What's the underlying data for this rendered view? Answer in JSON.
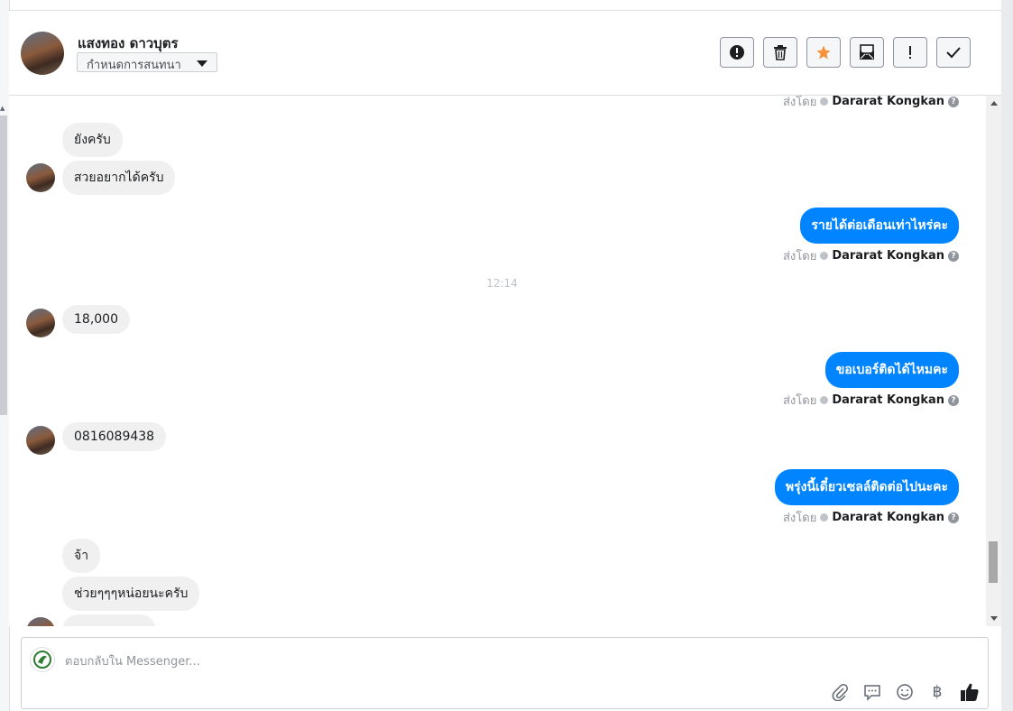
{
  "conversation": {
    "contact_name": "แสงทอง ดาวบุตร",
    "assign_label": "กำหนดการสนทนา"
  },
  "actions": [
    {
      "name": "report-spam-button",
      "icon": "alert-circle-icon"
    },
    {
      "name": "delete-button",
      "icon": "trash-icon"
    },
    {
      "name": "star-button",
      "icon": "star-icon",
      "color": "#f7923b"
    },
    {
      "name": "mark-unread-button",
      "icon": "envelope-open-icon"
    },
    {
      "name": "follow-up-button",
      "icon": "exclamation-icon"
    },
    {
      "name": "mark-done-button",
      "icon": "check-icon"
    }
  ],
  "messages": {
    "sent_by_prefix": "ส่งโดย",
    "agent": "Dararat Kongkan",
    "m1": "ยังครับ",
    "m2": "สวยอยากได้ครับ",
    "m3": "รายได้ต่อเดือนเท่าไหร่คะ",
    "time1": "12:14",
    "m4": "18,000",
    "m5": "ขอเบอร์ติดได้ไหมคะ",
    "m6": "0816089438",
    "m7": "พรุ่งนี้เดี๋ยวเซลล์ติดต่อไปนะคะ",
    "m8": "จ้า",
    "m9": "ช่วยๆๆๆหน่อยนะครับ"
  },
  "composer": {
    "placeholder": "ตอบกลับใน Messenger...",
    "tools": [
      "paperclip-icon",
      "quick-reply-icon",
      "emoji-icon",
      "baht-icon",
      "thumbs-up-icon"
    ],
    "baht_glyph": "฿"
  },
  "colors": {
    "outgoing_bubble": "#0084ff",
    "incoming_bubble": "#f1f0f0",
    "star": "#f7923b"
  }
}
